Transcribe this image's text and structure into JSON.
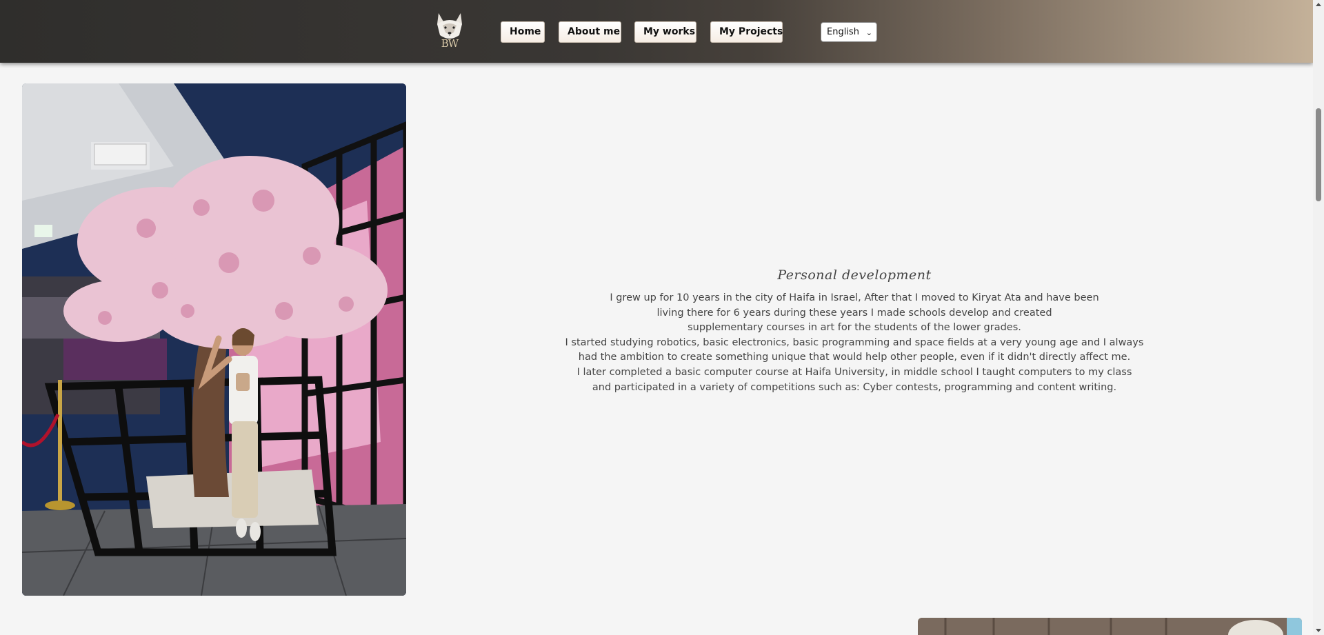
{
  "header": {
    "logo_text": "BW",
    "nav": {
      "home": "Home",
      "about": "About me",
      "works": "My works",
      "projects": "My Projects"
    },
    "language": {
      "selected": "English"
    }
  },
  "section": {
    "title": "Personal development",
    "lines": [
      "I grew up for 10 years in the city of Haifa in Israel, After that I moved to Kiryat Ata and have been",
      "living there for 6 years during these years I made schools develop and created",
      "supplementary courses in art for the students of the lower grades.",
      "I started studying robotics, basic electronics, basic programming and space fields at a very young age and I always",
      "had the ambition to create something unique that would help other people, even if it didn't directly affect me.",
      "I later completed a basic computer course at Haifa University, in middle school I taught computers to my class",
      "and participated in a variety of competitions such as: Cyber contests, programming and content writing."
    ]
  },
  "icons": {
    "logo": "wolf-logo-icon",
    "select_caret": "chevron-down-icon"
  },
  "colors": {
    "header_dark": "#2f2e2c",
    "header_light": "#c4b199",
    "page_background": "#f5f5f5",
    "text": "#444444"
  }
}
